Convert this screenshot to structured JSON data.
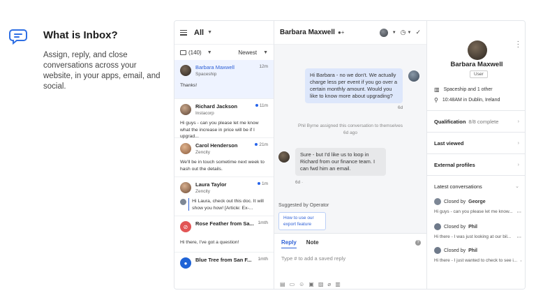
{
  "intro": {
    "title": "What is Inbox?",
    "description": "Assign, reply, and close conversations across your website, in your apps, email, and social."
  },
  "list": {
    "title": "All",
    "count": "(140)",
    "sort": "Newest",
    "conversations": [
      {
        "name": "Barbara Maxwell",
        "company": "Spaceship",
        "time": "12m",
        "preview": "Thanks!",
        "unread": false
      },
      {
        "name": "Richard Jackson",
        "company": "Instacorp",
        "time": "11m",
        "preview": "Hi guys - can you please let me know what the increase in price will be if I upgrad...",
        "unread": true
      },
      {
        "name": "Carol Henderson",
        "company": "Zencity",
        "time": "21m",
        "preview": "We'll be in touch sometime next week to hash out the details.",
        "unread": true
      },
      {
        "name": "Laura Taylor",
        "company": "Zencity",
        "time": "1m",
        "preview": "Hi Laura, check out this doc. It will show you how! [Article: Ex-...",
        "unread": true
      },
      {
        "name": "Rose Feather from Sa...",
        "company": "",
        "time": "1mth",
        "preview": "Hi there, I've got a question!",
        "unread": false
      },
      {
        "name": "Blue Tree from San F...",
        "company": "",
        "time": "1mth",
        "preview": "",
        "unread": false
      }
    ]
  },
  "chat": {
    "title": "Barbara Maxwell",
    "messages": [
      {
        "text": "Hi Barbara - no we don't. We actually charge less per event if you go over a certain monthly amount. Would you like to know more about upgrading?",
        "meta": "6d"
      },
      {
        "text": "Phil Byrne assigned this conversation to themselves",
        "meta": "6d ago"
      },
      {
        "text": "Sure - but I'd like us to loop in Richard from our finance team. I can fwd him an email.",
        "meta": "6d ·"
      }
    ],
    "suggested_label": "Suggested by Operator",
    "suggested_item": "How to use our export feature",
    "reply_tab": "Reply",
    "note_tab": "Note",
    "placeholder": "Type # to add a saved reply"
  },
  "details": {
    "name": "Barbara Maxwell",
    "badge": "User",
    "company_line": "Spaceship and 1 other",
    "location_line": "10:48AM in Dublin, Ireland",
    "sections": [
      {
        "label": "Qualification",
        "sub": "8/8 complete"
      },
      {
        "label": "Last viewed",
        "sub": ""
      },
      {
        "label": "External profiles",
        "sub": ""
      },
      {
        "label": "Latest conversations",
        "sub": ""
      }
    ],
    "latest": [
      {
        "closed_by": "Closed by",
        "agent": "George",
        "preview": "Hi guys - can you please let me know..."
      },
      {
        "closed_by": "Closed by",
        "agent": "Phil",
        "preview": "Hi there - I was just looking at our bil..."
      },
      {
        "closed_by": "Closed by",
        "agent": "Phil",
        "preview": "Hi there - I just wanted to check to see i..."
      }
    ]
  },
  "colors": {
    "accent": "#2c5fd6",
    "unread_dot": "#2563eb",
    "rose_avatar": "#e25555",
    "blue_avatar": "#1f63d6"
  }
}
